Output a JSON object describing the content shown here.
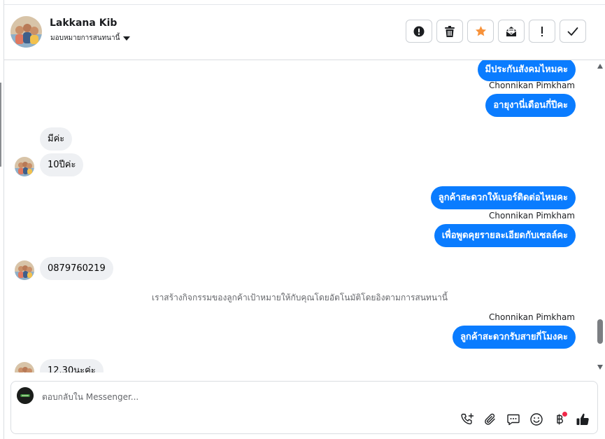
{
  "header": {
    "contact_name": "Lakkana Kib",
    "assign_label": "มอบหมายการสนทนานี้",
    "actions": [
      {
        "name": "report-spam-button",
        "icon": "alert-circle-icon"
      },
      {
        "name": "delete-button",
        "icon": "trash-icon"
      },
      {
        "name": "star-button",
        "icon": "star-icon"
      },
      {
        "name": "mark-unread-button",
        "icon": "envelope-icon"
      },
      {
        "name": "follow-up-button",
        "icon": "exclamation-icon"
      },
      {
        "name": "mark-done-button",
        "icon": "checkmark-icon"
      }
    ]
  },
  "messages": {
    "m1": "มีประกันสังคมไหมคะ",
    "sender1": "Chonnikan Pimkham",
    "m2": "อายุงานี่เดือนกี่ปีคะ",
    "m3": "มีค่ะ",
    "m4": "10ปีค่ะ",
    "m5": "ลูกค้าสะดวกให้เบอร์ติดต่อไหมคะ",
    "sender2": "Chonnikan Pimkham",
    "m6": "เพื่อพูดคุยรายละเอียดกับเซลล์คะ",
    "m7": "0879760219",
    "system_note": "เราสร้างกิจกรรมของลูกค้าเป้าหมายให้กับคุณโดยอัตโนมัติโดยอิงตามการสนทนานี้",
    "sender3": "Chonnikan Pimkham",
    "m8": "ลูกค้าสะดวกรับสายกี่โมงคะ",
    "m9": "12.30นะค่ะ"
  },
  "composer": {
    "placeholder": "ตอบกลับใน Messenger...",
    "tools": [
      "phone-plus-icon",
      "paperclip-icon",
      "chat-bubble-icon",
      "smiley-icon",
      "baht-icon",
      "thumbs-up-icon"
    ]
  },
  "colors": {
    "accent": "#0a7cff",
    "star": "#f7923a",
    "incoming_bubble": "#eef0f3",
    "notification_dot": "#f02849"
  }
}
